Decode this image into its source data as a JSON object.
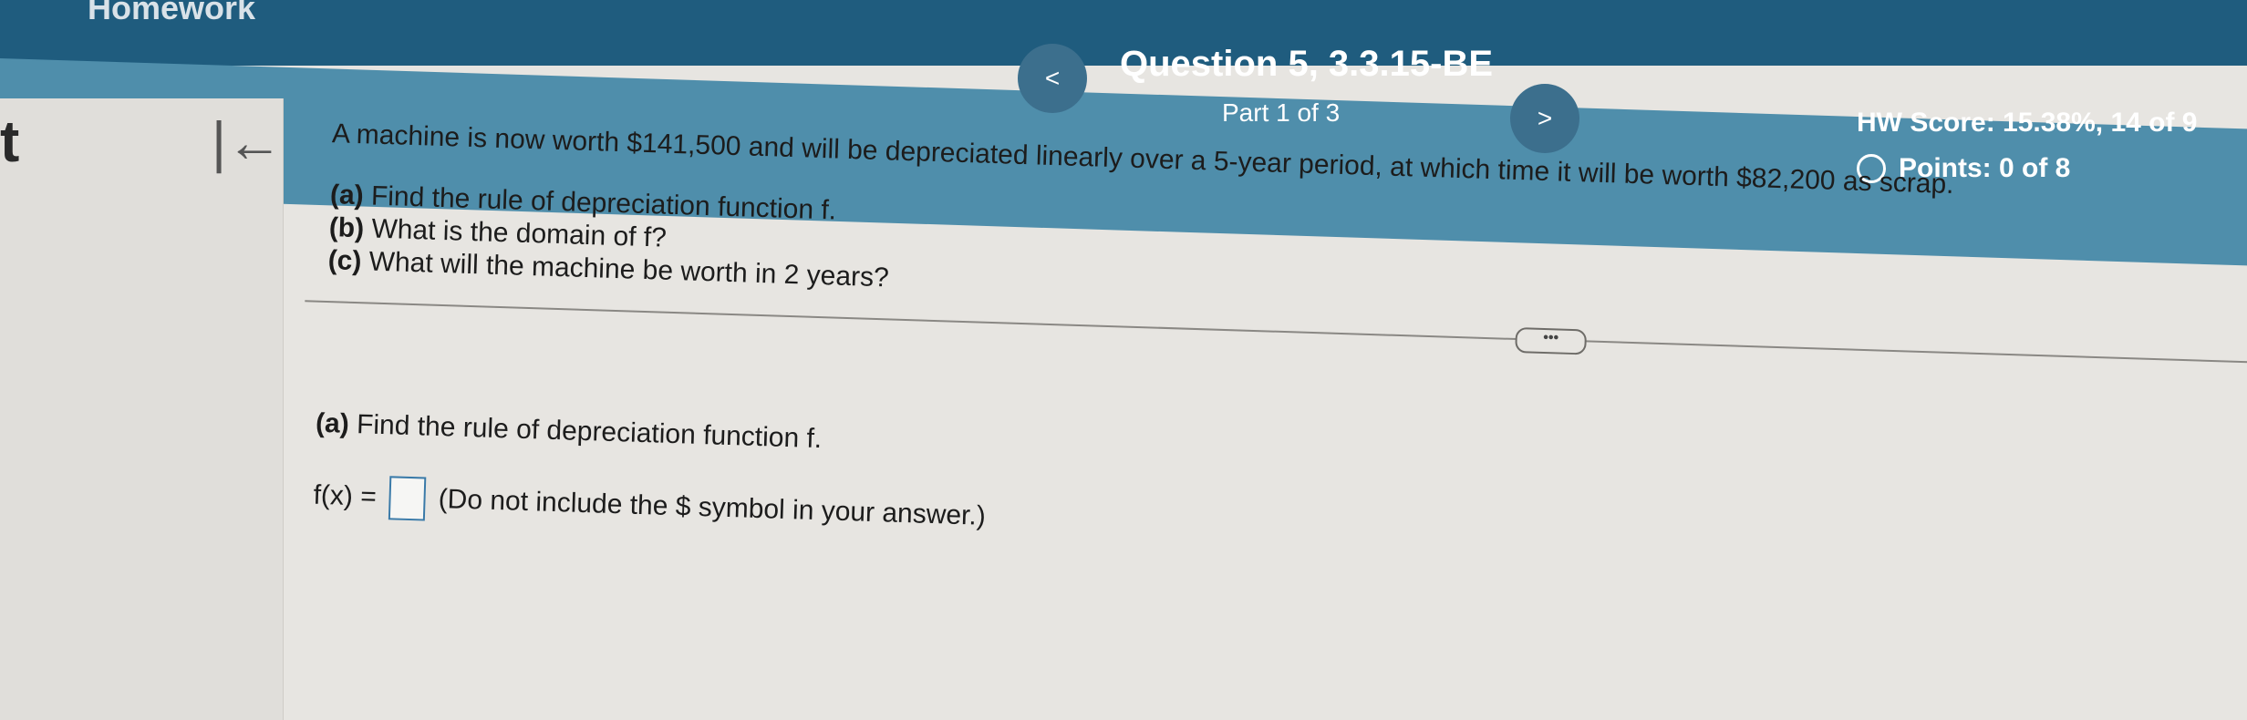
{
  "app": {
    "title": "Homework",
    "sidebar_letter": "t"
  },
  "nav": {
    "prev_label": "<",
    "next_label": ">",
    "first_label": "|←"
  },
  "question": {
    "title": "Question 5, 3.3.15-BE",
    "part": "Part 1 of 3"
  },
  "score": {
    "hw_score": "HW Score: 15.38%, 14 of 9",
    "points": "Points: 0 of 8"
  },
  "problem": {
    "statement": "A machine is now worth $141,500 and will be depreciated linearly over a 5-year period, at which time it will be worth $82,200 as scrap.",
    "parts": [
      {
        "tag": "(a)",
        "text": "Find the rule of depreciation function f."
      },
      {
        "tag": "(b)",
        "text": "What is the domain of f?"
      },
      {
        "tag": "(c)",
        "text": "What will the machine be worth in 2 years?"
      }
    ]
  },
  "more_button": "•••",
  "answer": {
    "tag": "(a)",
    "prompt": "Find the rule of depreciation function f.",
    "lhs": "f(x) =",
    "value": "",
    "note": "(Do not include the $ symbol in your answer.)"
  },
  "colors": {
    "header": "#4f8eab",
    "topbar": "#1f5c7e",
    "background": "#e7e5e1"
  }
}
